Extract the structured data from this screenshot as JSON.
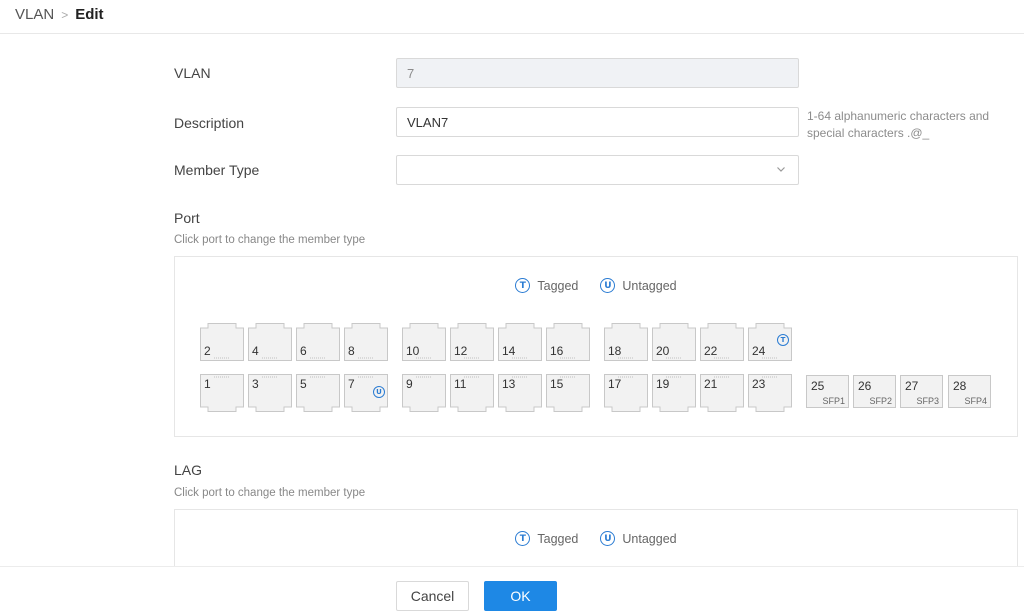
{
  "breadcrumb": {
    "root": "VLAN",
    "separator": ">",
    "current": "Edit"
  },
  "form": {
    "vlan_label": "VLAN",
    "vlan_value": "7",
    "description_label": "Description",
    "description_value": "VLAN7",
    "description_hint": "1-64 alphanumeric characters and special characters .@_",
    "member_type_label": "Member Type",
    "member_type_value": ""
  },
  "port_section": {
    "title": "Port",
    "subtitle": "Click port to change the member type",
    "legend": {
      "tagged_symbol": "T",
      "tagged_label": "Tagged",
      "untagged_symbol": "U",
      "untagged_label": "Untagged"
    },
    "top_row": [
      {
        "num": "2"
      },
      {
        "num": "4"
      },
      {
        "num": "6"
      },
      {
        "num": "8"
      },
      {
        "num": "10"
      },
      {
        "num": "12"
      },
      {
        "num": "14"
      },
      {
        "num": "16"
      },
      {
        "num": "18"
      },
      {
        "num": "20"
      },
      {
        "num": "22"
      },
      {
        "num": "24",
        "badge": "T"
      }
    ],
    "bottom_row": [
      {
        "num": "1"
      },
      {
        "num": "3"
      },
      {
        "num": "5"
      },
      {
        "num": "7",
        "badge": "U"
      },
      {
        "num": "9"
      },
      {
        "num": "11"
      },
      {
        "num": "13"
      },
      {
        "num": "15"
      },
      {
        "num": "17"
      },
      {
        "num": "19"
      },
      {
        "num": "21"
      },
      {
        "num": "23"
      }
    ],
    "sfp_ports": [
      {
        "num": "25",
        "name": "SFP1"
      },
      {
        "num": "26",
        "name": "SFP2"
      },
      {
        "num": "27",
        "name": "SFP3"
      },
      {
        "num": "28",
        "name": "SFP4"
      }
    ]
  },
  "lag_section": {
    "title": "LAG",
    "subtitle": "Click port to change the member type",
    "legend": {
      "tagged_symbol": "T",
      "tagged_label": "Tagged",
      "untagged_symbol": "U",
      "untagged_label": "Untagged"
    }
  },
  "footer": {
    "cancel_label": "Cancel",
    "ok_label": "OK"
  },
  "colors": {
    "accent": "#1e88e5",
    "badge": "#2b7cd3"
  }
}
